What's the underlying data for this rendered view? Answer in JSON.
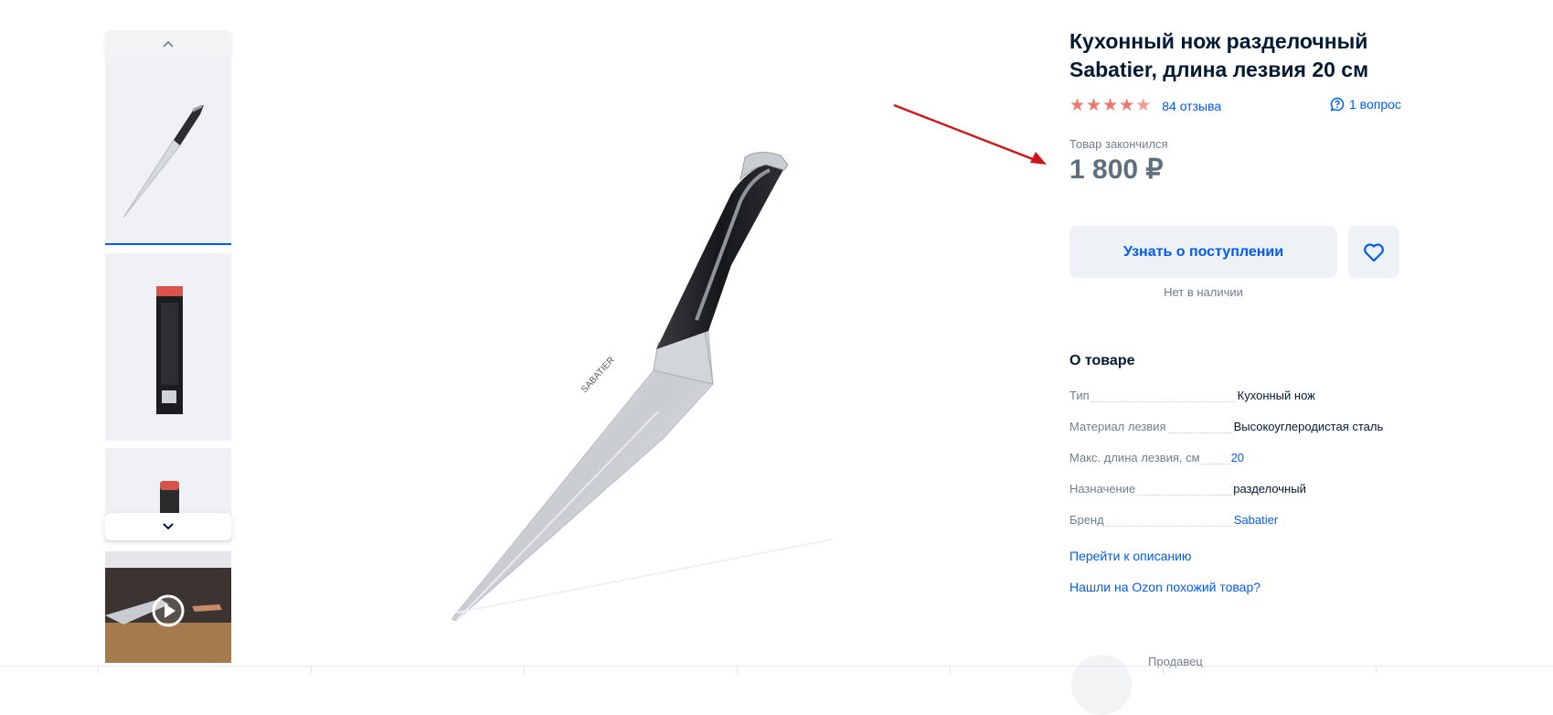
{
  "product": {
    "title": "Кухонный нож разделочный Sabatier, длина лезвия 20 см",
    "rating_value": 4.5,
    "reviews_label": "84 отзыва",
    "questions_label": "1 вопрос",
    "status_label": "Товар закончился",
    "price": "1 800 ₽",
    "notify_label": "Узнать о поступлении",
    "no_stock_label": "Нет в наличии"
  },
  "about": {
    "title": "О товаре",
    "specs": [
      {
        "name": "Тип",
        "value": "Кухонный нож",
        "link": false
      },
      {
        "name": "Материал лезвия",
        "value": "Высокоуглеродистая сталь",
        "link": false
      },
      {
        "name": "Макс. длина лезвия, см",
        "value": "20",
        "link": true
      },
      {
        "name": "Назначение",
        "value": "разделочный",
        "link": false
      },
      {
        "name": "Бренд",
        "value": "Sabatier",
        "link": true
      }
    ],
    "go_to_description": "Перейти к описанию",
    "found_similar": "Нашли на Ozon похожий товар?"
  },
  "seller": {
    "label": "Продавец"
  },
  "colors": {
    "accent": "#005bff",
    "stars": "#f5736a",
    "annotation_arrow": "#d0141a"
  },
  "icons": {
    "thumb_up": "chevron-up-icon",
    "thumb_down": "chevron-down-icon",
    "play": "play-icon",
    "favorite": "heart-icon",
    "question": "question-bubble-icon",
    "star": "star-icon"
  }
}
